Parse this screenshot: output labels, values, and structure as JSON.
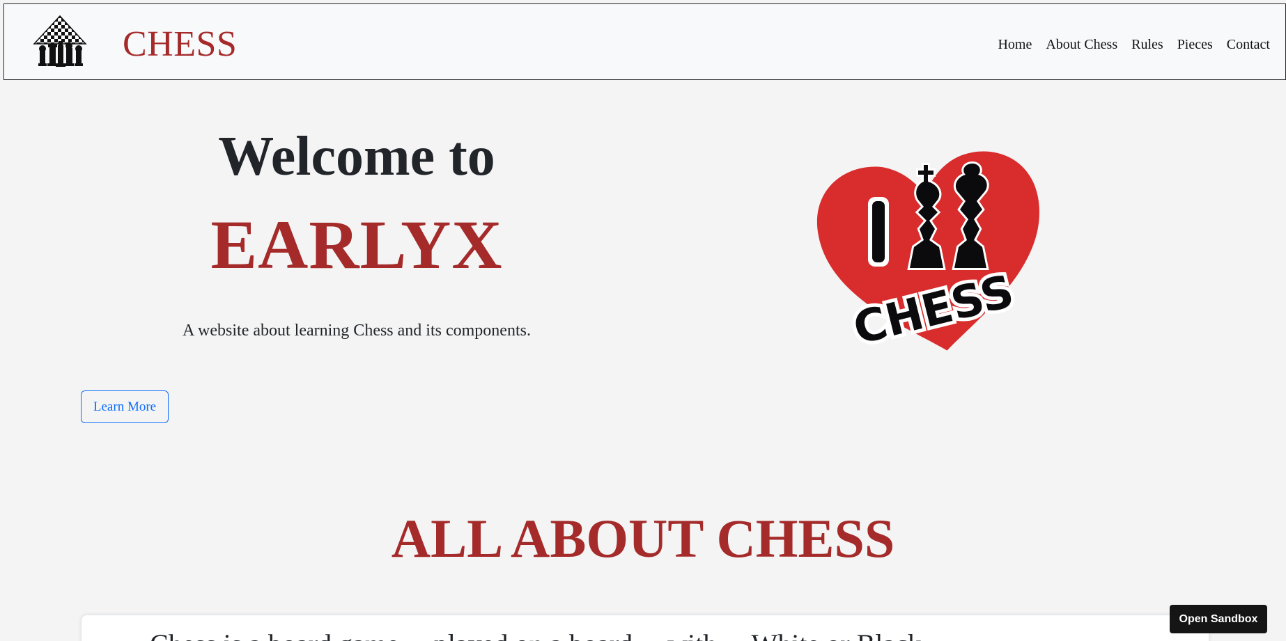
{
  "navbar": {
    "brand_name": "CHESS",
    "links": [
      "Home",
      "About Chess",
      "Rules",
      "Pieces",
      "Contact"
    ]
  },
  "hero": {
    "welcome": "Welcome to",
    "site_name": "EARLYX",
    "tagline": "A website about learning Chess and its components.",
    "learn_more_label": "Learn More",
    "image_text": "I CHESS"
  },
  "section": {
    "title": "ALL ABOUT CHESS",
    "card_text": "Chess is a board game ... played on a board ... with ... White or Black"
  },
  "sandbox": {
    "label": "Open Sandbox"
  },
  "colors": {
    "accent": "#a52a2a",
    "button_blue": "#0d6efd",
    "heart_red": "#d92c2c",
    "navbar_bg": "#f8f9fb",
    "page_bg": "#f4f4f4"
  }
}
